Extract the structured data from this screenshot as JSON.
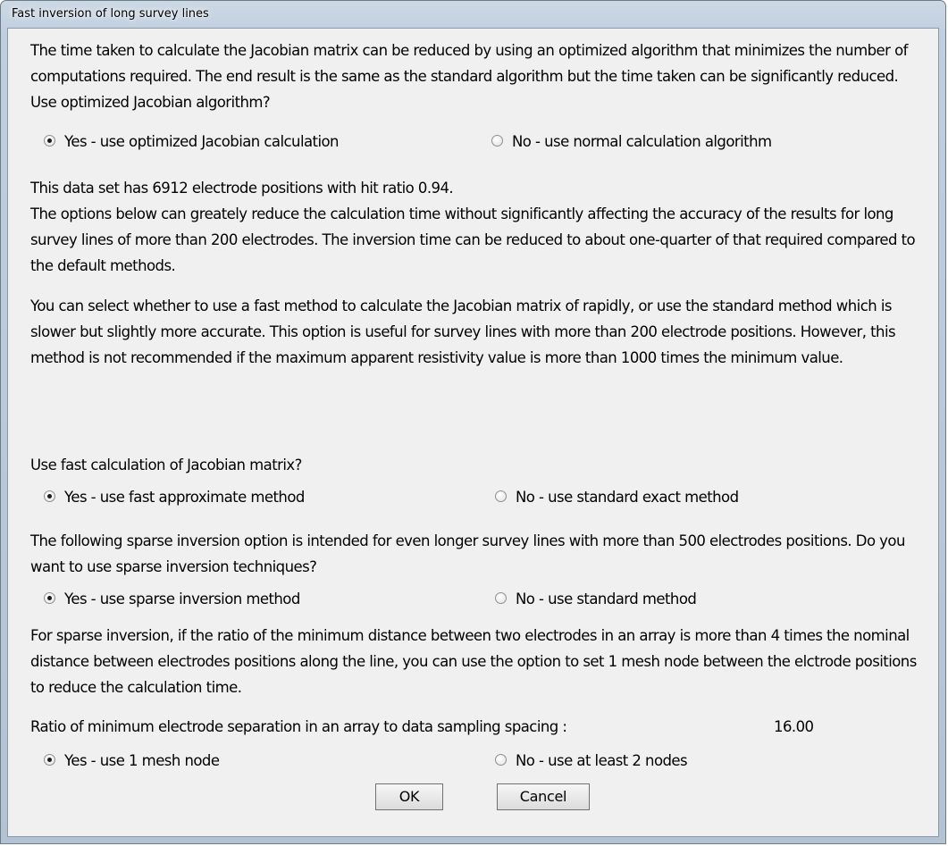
{
  "window": {
    "title": "Fast inversion of long survey lines"
  },
  "jacobian_optimized": {
    "text": "The time taken to calculate the Jacobian matrix can be reduced by using an optimized algorithm that minimizes the number of computations required. The end result is the same as the standard algorithm but the time taken can be significantly reduced. Use optimized Jacobian algorithm?",
    "yes_label": "Yes - use optimized Jacobian calculation",
    "no_label": "No - use normal calculation algorithm",
    "selected": "yes"
  },
  "dataset_info": "This data set has 6912 electrode positions with hit ratio 0.94.",
  "options_intro": "The options below can greately reduce the calculation time without significantly affecting the accuracy of the results for long survey lines of more than 200 electrodes. The inversion time can be reduced to about one-quarter of that required compared to the default methods.",
  "fast_jacobian": {
    "text": "You can select whether to use a fast method to calculate the Jacobian matrix of rapidly, or use the standard method which is slower but slightly more accurate. This option is useful  for survey lines with more than 200 electrode positions. However, this method is  not recommended if the maximum apparent resistivity value is more than 1000 times the minimum value.",
    "question": "Use fast calculation of Jacobian matrix?",
    "yes_label": "Yes - use fast approximate method",
    "no_label": "No - use standard exact method",
    "selected": "yes"
  },
  "sparse_inversion": {
    "text": "The following sparse inversion option is intended for even longer survey lines with more than 500 electrodes positions. Do you want to use sparse inversion techniques?",
    "yes_label": "Yes - use sparse inversion method",
    "no_label": "No - use standard method",
    "selected": "yes"
  },
  "mesh_node": {
    "text": "For sparse inversion, if the ratio of the minimum distance between two electrodes in an array is more than 4 times the nominal distance between electrodes positions along the line, you can use the option to set 1 mesh node between the elctrode positions to reduce the calculation time.",
    "ratio_label": "Ratio of minimum electrode separation in an array to data sampling spacing :",
    "ratio_value": "16.00",
    "yes_label": "Yes - use 1 mesh node",
    "no_label": "No - use at least 2 nodes",
    "selected": "yes"
  },
  "buttons": {
    "ok": "OK",
    "cancel": "Cancel"
  }
}
